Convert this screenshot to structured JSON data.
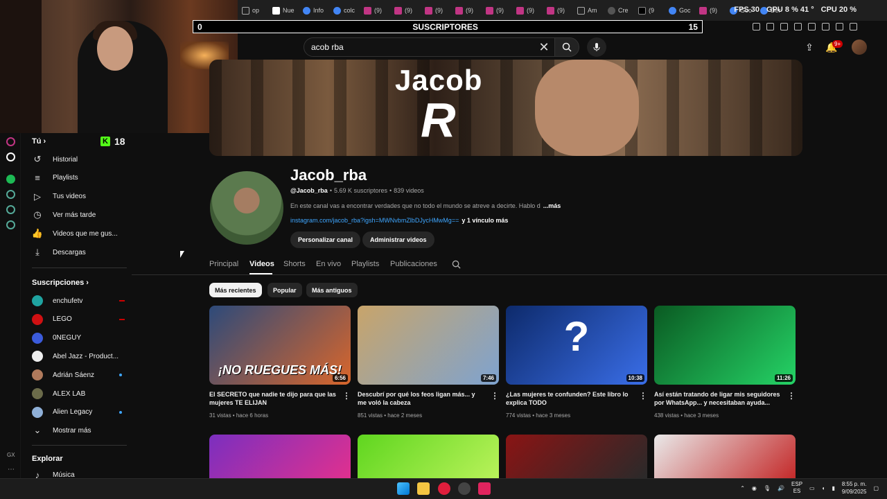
{
  "browser": {
    "tabs": [
      {
        "label": "op",
        "fav": "a"
      },
      {
        "label": "Nue",
        "fav": "n"
      },
      {
        "label": "Info",
        "fav": "g"
      },
      {
        "label": "colc",
        "fav": "g"
      },
      {
        "label": "(9)",
        "fav": "i"
      },
      {
        "label": "(9)",
        "fav": "i"
      },
      {
        "label": "(9)",
        "fav": "i"
      },
      {
        "label": "(9)",
        "fav": "i"
      },
      {
        "label": "(9)",
        "fav": "i"
      },
      {
        "label": "(9)",
        "fav": "i"
      },
      {
        "label": "(9)",
        "fav": "i"
      },
      {
        "label": "Am",
        "fav": "a"
      },
      {
        "label": "Cre",
        "fav": "c"
      },
      {
        "label": "(9",
        "fav": "t"
      },
      {
        "label": "Goc",
        "fav": "g"
      },
      {
        "label": "(9)",
        "fav": "i"
      },
      {
        "label": "Goo",
        "fav": "g"
      },
      {
        "label": "Der",
        "fav": "g"
      }
    ],
    "perf": {
      "fps_label": "FPS",
      "fps_value": "30",
      "gpu_label": "GPU",
      "gpu_value": "8 %",
      "temp": "41 °",
      "cpu_label": "CPU",
      "cpu_value": "20 %"
    }
  },
  "overlay": {
    "sub_left": "0",
    "sub_label": "SUSCRIPTORES",
    "sub_right": "15",
    "kick_count": "18"
  },
  "search": {
    "value": "acob rba",
    "notif_badge": "9+"
  },
  "sidebar": {
    "you_label": "Tú",
    "you_items": [
      {
        "label": "Historial",
        "icon": "history-icon",
        "glyph": "↺"
      },
      {
        "label": "Playlists",
        "icon": "playlist-icon",
        "glyph": "≡"
      },
      {
        "label": "Tus videos",
        "icon": "your-videos-icon",
        "glyph": "▷"
      },
      {
        "label": "Ver más tarde",
        "icon": "watch-later-icon",
        "glyph": "◷"
      },
      {
        "label": "Videos que me gus...",
        "icon": "like-icon",
        "glyph": "👍"
      },
      {
        "label": "Descargas",
        "icon": "download-icon",
        "glyph": "⤓"
      }
    ],
    "subs_label": "Suscripciones",
    "subs": [
      {
        "label": "enchufetv",
        "color": "#1fa3a0",
        "marker": "live"
      },
      {
        "label": "LEGO",
        "color": "#d01012",
        "marker": "live"
      },
      {
        "label": "0NEGUY",
        "color": "#3b5bdb",
        "marker": ""
      },
      {
        "label": "Abel Jazz - Product...",
        "color": "#eeeeee",
        "marker": ""
      },
      {
        "label": "Adrián Sáenz",
        "color": "#b07a5c",
        "marker": "dot"
      },
      {
        "label": "ALEX LAB",
        "color": "#6b6b4a",
        "marker": ""
      },
      {
        "label": "Alien Legacy",
        "color": "#8fb0d8",
        "marker": "dot"
      }
    ],
    "show_more": "Mostrar más",
    "explore_label": "Explorar",
    "music_label": "Música"
  },
  "channel": {
    "banner_title": "Jacob",
    "banner_logo": "R",
    "name": "Jacob_rba",
    "handle": "@Jacob_rba",
    "subscribers": "5.69 K suscriptores",
    "videos": "839 videos",
    "description": "En este canal vas a encontrar verdades que no todo el mundo se atreve a decirte. Hablo d",
    "more": "...más",
    "link": "instagram.com/jacob_rba?igsh=MWNvbmZlbDJycHMwMg==",
    "link_more": "y 1 vínculo más",
    "btn_customize": "Personalizar canal",
    "btn_manage": "Administrar videos"
  },
  "tabs": [
    "Principal",
    "Videos",
    "Shorts",
    "En vivo",
    "Playlists",
    "Publicaciones"
  ],
  "chips": [
    "Más recientes",
    "Popular",
    "Más antiguos"
  ],
  "videos": [
    {
      "title": "El SECRETO que nadie te dijo para que las mujeres TE ELIJAN",
      "views": "31 vistas",
      "age": "hace 6 horas",
      "duration": "6:56",
      "overlay": "¡NO RUEGUES MÁS!",
      "bg1": "#2d4a7a",
      "bg2": "#d9662b"
    },
    {
      "title": "Descubrí por qué los feos ligan más... y me voló la cabeza",
      "views": "851 vistas",
      "age": "hace 2 meses",
      "duration": "7:46",
      "overlay": "",
      "bg1": "#c8a46a",
      "bg2": "#7ea3d0"
    },
    {
      "title": "¿Las mujeres te confunden? Este libro lo explica TODO",
      "views": "774 vistas",
      "age": "hace 3 meses",
      "duration": "10:38",
      "overlay": "?",
      "bg1": "#0d2a6b",
      "bg2": "#3a6ee8"
    },
    {
      "title": "Así están tratando de ligar mis seguidores por WhatsApp... y necesitaban ayuda...",
      "views": "438 vistas",
      "age": "hace 3 meses",
      "duration": "11:26",
      "overlay": "",
      "bg1": "#0a5a22",
      "bg2": "#25d366"
    }
  ],
  "row2_colors": [
    {
      "bg1": "#7b2fbf",
      "bg2": "#e0308f"
    },
    {
      "bg1": "#5fd61f",
      "bg2": "#b9f25a"
    },
    {
      "bg1": "#8a1414",
      "bg2": "#2a2a2a"
    },
    {
      "bg1": "#e9e9e9",
      "bg2": "#c42a2a"
    }
  ],
  "taskbar": {
    "lang": "ESP",
    "lang2": "ES",
    "time": "8:55 p. m.",
    "date": "9/09/2025"
  }
}
